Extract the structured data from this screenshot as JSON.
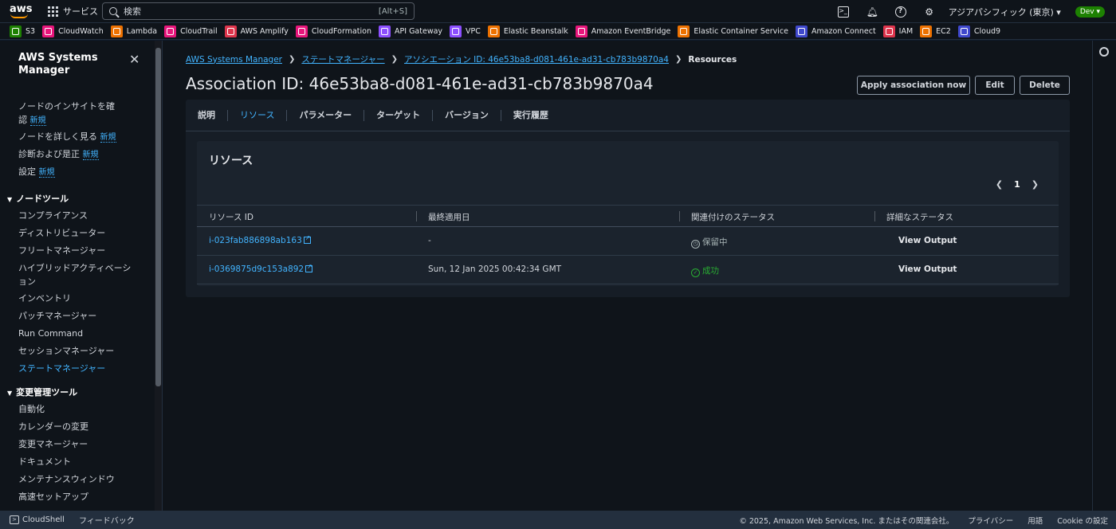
{
  "topnav": {
    "logo": "aws",
    "services": "サービス",
    "search_placeholder": "検索",
    "search_shortcut": "[Alt+S]",
    "region": "アジアパシフィック (東京)",
    "account": "Dev"
  },
  "favorites": [
    {
      "label": "S3",
      "color": "#1d8102",
      "icon": "s3-icon"
    },
    {
      "label": "CloudWatch",
      "color": "#e7157b",
      "icon": "cloudwatch-icon"
    },
    {
      "label": "Lambda",
      "color": "#ed7100",
      "icon": "lambda-icon"
    },
    {
      "label": "CloudTrail",
      "color": "#e7157b",
      "icon": "cloudtrail-icon"
    },
    {
      "label": "AWS Amplify",
      "color": "#dd344c",
      "icon": "amplify-icon"
    },
    {
      "label": "CloudFormation",
      "color": "#e7157b",
      "icon": "cloudformation-icon"
    },
    {
      "label": "API Gateway",
      "color": "#8c4fff",
      "icon": "api-gateway-icon"
    },
    {
      "label": "VPC",
      "color": "#8c4fff",
      "icon": "vpc-icon"
    },
    {
      "label": "Elastic Beanstalk",
      "color": "#ed7100",
      "icon": "beanstalk-icon"
    },
    {
      "label": "Amazon EventBridge",
      "color": "#e7157b",
      "icon": "eventbridge-icon"
    },
    {
      "label": "Elastic Container Service",
      "color": "#ed7100",
      "icon": "ecs-icon"
    },
    {
      "label": "Amazon Connect",
      "color": "#3f48cc",
      "icon": "connect-icon"
    },
    {
      "label": "IAM",
      "color": "#dd344c",
      "icon": "iam-icon"
    },
    {
      "label": "EC2",
      "color": "#ed7100",
      "icon": "ec2-icon"
    },
    {
      "label": "Cloud9",
      "color": "#3f48cc",
      "icon": "cloud9-icon"
    }
  ],
  "sidebar": {
    "title": "AWS Systems Manager",
    "new_badge": "新規",
    "top_items": [
      {
        "label": "ノードのインサイトを確認",
        "new": true
      },
      {
        "label": "ノードを詳しく見る",
        "new": true
      },
      {
        "label": "診断および是正",
        "new": true
      },
      {
        "label": "設定",
        "new": true
      }
    ],
    "section1": "ノードツール",
    "section1_items": [
      "コンプライアンス",
      "ディストリビューター",
      "フリートマネージャー",
      "ハイブリッドアクティベーション",
      "インベントリ",
      "パッチマネージャー",
      "Run Command",
      "セッションマネージャー",
      "ステートマネージャー"
    ],
    "section2": "変更管理ツール",
    "section2_items": [
      "自動化",
      "カレンダーの変更",
      "変更マネージャー",
      "ドキュメント",
      "メンテナンスウィンドウ",
      "高速セットアップ"
    ]
  },
  "breadcrumb": [
    {
      "label": "AWS Systems Manager",
      "link": true
    },
    {
      "label": "ステートマネージャー",
      "link": true
    },
    {
      "label": "アソシエーション ID: 46e53ba8-d081-461e-ad31-cb783b9870a4",
      "link": true
    },
    {
      "label": "Resources",
      "link": false
    }
  ],
  "page": {
    "title": "Association ID: 46e53ba8-d081-461e-ad31-cb783b9870a4",
    "apply_button": "Apply association now",
    "edit_button": "Edit",
    "delete_button": "Delete"
  },
  "tabs": [
    {
      "label": "説明",
      "active": false
    },
    {
      "label": "リソース",
      "active": true
    },
    {
      "label": "パラメーター",
      "active": false
    },
    {
      "label": "ターゲット",
      "active": false
    },
    {
      "label": "バージョン",
      "active": false
    },
    {
      "label": "実行履歴",
      "active": false
    }
  ],
  "resources": {
    "title": "リソース",
    "page_number": "1",
    "columns": [
      "リソース ID",
      "最終適用日",
      "関連付けのステータス",
      "詳細なステータス"
    ],
    "rows": [
      {
        "id": "i-023fab886898ab163",
        "last_applied": "-",
        "status": "保留中",
        "status_type": "pending",
        "detail": "View Output"
      },
      {
        "id": "i-0369875d9c153a892",
        "last_applied": "Sun, 12 Jan 2025 00:42:34 GMT",
        "status": "成功",
        "status_type": "success",
        "detail": "View Output"
      }
    ]
  },
  "footer": {
    "cloudshell": "CloudShell",
    "feedback": "フィードバック",
    "copyright": "© 2025, Amazon Web Services, Inc. またはその関連会社。",
    "privacy": "プライバシー",
    "terms": "用語",
    "cookies": "Cookie の設定"
  }
}
